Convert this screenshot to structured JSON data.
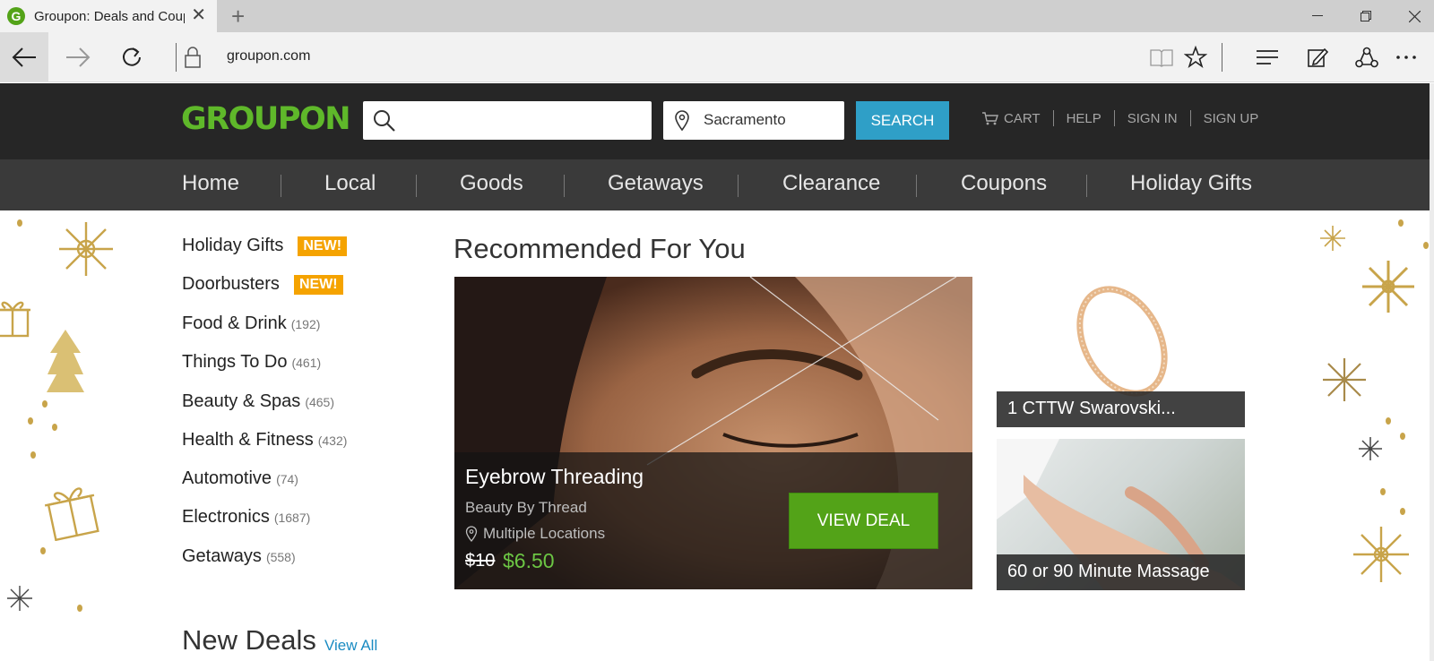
{
  "browser": {
    "tab_title": "Groupon: Deals and Coupons",
    "favicon_letter": "G",
    "new_tab_symbol": "+",
    "url": "groupon.com"
  },
  "header": {
    "logo": "GROUPON",
    "search_placeholder": "",
    "location": "Sacramento",
    "search_button": "SEARCH",
    "links": [
      "CART",
      "HELP",
      "SIGN IN",
      "SIGN UP"
    ]
  },
  "nav": {
    "categories": [
      "Home",
      "Local",
      "Goods",
      "Getaways",
      "Clearance",
      "Coupons",
      "Holiday Gifts"
    ]
  },
  "left_menu": {
    "items": [
      {
        "label": "Holiday Gifts",
        "count": "",
        "badge": "NEW!"
      },
      {
        "label": "Doorbusters",
        "count": "",
        "badge": "NEW!"
      },
      {
        "label": "Food & Drink",
        "count": "(192)",
        "badge": ""
      },
      {
        "label": "Things To Do",
        "count": "(461)",
        "badge": ""
      },
      {
        "label": "Beauty & Spas",
        "count": "(465)",
        "badge": ""
      },
      {
        "label": "Health & Fitness",
        "count": "(432)",
        "badge": ""
      },
      {
        "label": "Automotive",
        "count": "(74)",
        "badge": ""
      },
      {
        "label": "Electronics",
        "count": "(1687)",
        "badge": ""
      },
      {
        "label": "Getaways",
        "count": "(558)",
        "badge": ""
      }
    ]
  },
  "recommended": {
    "title": "Recommended For You",
    "hero": {
      "title": "Eyebrow Threading",
      "merchant": "Beauty By Thread",
      "location": "Multiple Locations",
      "old_price": "$10",
      "new_price": "$6.50",
      "cta": "VIEW DEAL"
    },
    "side_cards": [
      {
        "caption": "1 CTTW Swarovski..."
      },
      {
        "caption": "60 or 90 Minute Massage"
      }
    ]
  },
  "new_deals": {
    "title": "New Deals",
    "view_all": "View All"
  },
  "colors": {
    "brand_green": "#5fb82a",
    "search_blue": "#2f9fc7",
    "badge_orange": "#f5a300",
    "header_bg": "#262626",
    "nav_bg": "#3a3a3a",
    "gold_deco": "#c8a44a"
  }
}
